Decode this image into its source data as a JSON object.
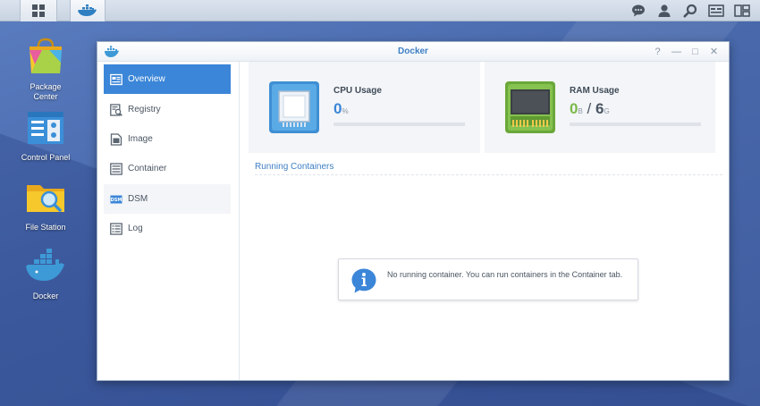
{
  "desktop": {
    "icons": [
      {
        "label_line1": "Package",
        "label_line2": "Center",
        "icon": "package-center-icon"
      },
      {
        "label_line1": "Control Panel",
        "label_line2": "",
        "icon": "control-panel-icon"
      },
      {
        "label_line1": "File Station",
        "label_line2": "",
        "icon": "file-station-icon"
      },
      {
        "label_line1": "Docker",
        "label_line2": "",
        "icon": "docker-icon"
      }
    ]
  },
  "taskbar": {
    "right_icons": [
      "chat-icon",
      "user-icon",
      "search-icon",
      "widgets-icon",
      "window-icon"
    ]
  },
  "window": {
    "title": "Docker",
    "controls": [
      "?",
      "—",
      "□",
      "✕"
    ]
  },
  "sidebar": {
    "items": [
      {
        "label": "Overview",
        "icon": "overview-icon"
      },
      {
        "label": "Registry",
        "icon": "registry-icon"
      },
      {
        "label": "Image",
        "icon": "image-icon"
      },
      {
        "label": "Container",
        "icon": "container-icon"
      },
      {
        "label": "DSM",
        "icon": "dsm-icon"
      },
      {
        "label": "Log",
        "icon": "log-icon"
      }
    ],
    "active_index": 0
  },
  "overview": {
    "cpu": {
      "label": "CPU Usage",
      "value": "0",
      "unit": "%",
      "usage_percent": 0
    },
    "ram": {
      "label": "RAM Usage",
      "used": "0",
      "used_unit": "B",
      "separator": "/",
      "total": "6",
      "total_unit": "G",
      "usage_percent": 0
    },
    "running_containers_title": "Running Containers",
    "empty_message": "No running container. You can run containers in the Container tab."
  },
  "colors": {
    "accent": "#3b86d8",
    "title_blue": "#3d7fc4",
    "cpu_value": "#3b86d8",
    "ram_value": "#7cb84a"
  }
}
